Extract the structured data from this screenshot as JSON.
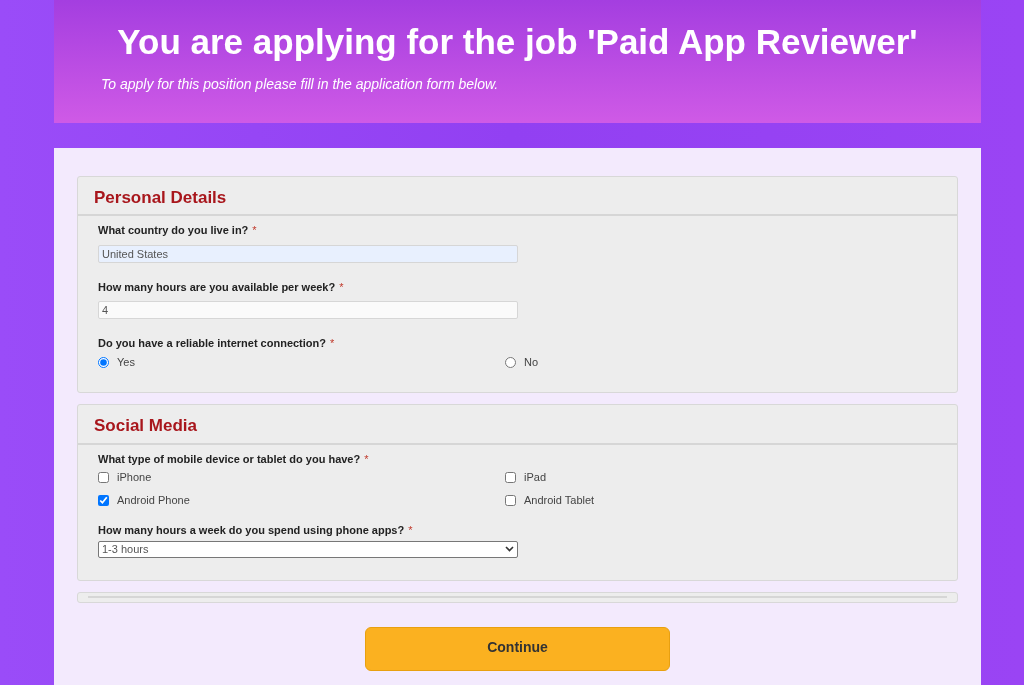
{
  "header": {
    "title": "You are applying for the job 'Paid App Reviewer'",
    "subtitle": "To apply for this position please fill in the application form below."
  },
  "sections": [
    {
      "title": "Personal Details",
      "questions": [
        {
          "kind": "text",
          "label": "What country do you live in?",
          "required_mark": "*",
          "value": "United States",
          "autofilled": true
        },
        {
          "kind": "text",
          "label": "How many hours are you available per week?",
          "required_mark": "*",
          "value": "4",
          "autofilled": false
        },
        {
          "kind": "radio",
          "label": "Do you have a reliable internet connection?",
          "required_mark": "*",
          "options": [
            {
              "label": "Yes",
              "selected": true
            },
            {
              "label": "No",
              "selected": false
            }
          ]
        }
      ]
    },
    {
      "title": "Social Media",
      "questions": [
        {
          "kind": "checkbox",
          "label": "What type of mobile device or tablet do you have?",
          "required_mark": "*",
          "options": [
            {
              "label": "iPhone",
              "checked": false
            },
            {
              "label": "iPad",
              "checked": false
            },
            {
              "label": "Android Phone",
              "checked": true
            },
            {
              "label": "Android Tablet",
              "checked": false
            }
          ]
        },
        {
          "kind": "select",
          "label": "How many hours a week do you spend using phone apps?",
          "required_mark": "*",
          "value": "1-3 hours"
        }
      ]
    }
  ],
  "continue_button": "Continue"
}
